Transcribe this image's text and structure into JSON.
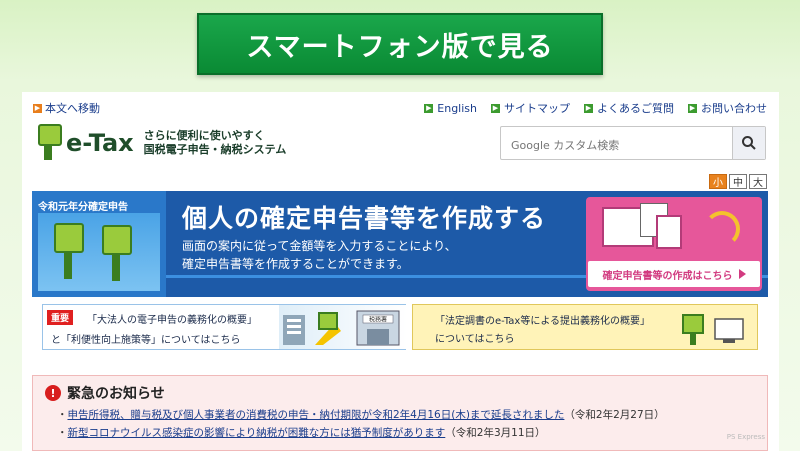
{
  "smartphone_banner": {
    "label": "スマートフォン版で見る"
  },
  "skip_link": {
    "label": "本文へ移動"
  },
  "top_links": [
    {
      "label": "English"
    },
    {
      "label": "サイトマップ"
    },
    {
      "label": "よくあるご質問"
    },
    {
      "label": "お問い合わせ"
    }
  ],
  "logo": {
    "name": "e-Tax",
    "tagline_1": "さらに便利に使いやすく",
    "tagline_2": "国税電子申告・納税システム"
  },
  "search": {
    "placeholder": "Google カスタム検索"
  },
  "font_size": {
    "small": "小",
    "medium": "中",
    "large": "大",
    "active": "small"
  },
  "hero": {
    "year_label": "令和元年分確定申告",
    "title": "個人の確定申告書等を作成する",
    "desc_1": "画面の案内に従って金額等を入力することにより、",
    "desc_2": "確定申告書等を作成することができます。",
    "cta": "確定申告書等の作成はこちら",
    "colors": {
      "bg": "#1d5aa8",
      "cta": "#e6579a"
    }
  },
  "banner_left": {
    "tag": "重要",
    "line_1": "「大法人の電子申告の義務化の概要」",
    "line_2": "と「利便性向上施策等」についてはこちら",
    "sign": "税務署"
  },
  "banner_right": {
    "line_1": "「法定調書のe-Tax等による提出義務化の概要」",
    "line_2": "についてはこちら"
  },
  "emergency": {
    "title": "緊急のお知らせ",
    "items": [
      {
        "link": "申告所得税、贈与税及び個人事業者の消費税の申告・納付期限が令和2年4月16日(木)まで延長されました",
        "date": "（令和2年2月27日）"
      },
      {
        "link": "新型コロナウイルス感染症の影響により納税が困難な方には猶予制度があります",
        "date": "（令和2年3月11日）"
      }
    ]
  },
  "watermark": "PS Express"
}
